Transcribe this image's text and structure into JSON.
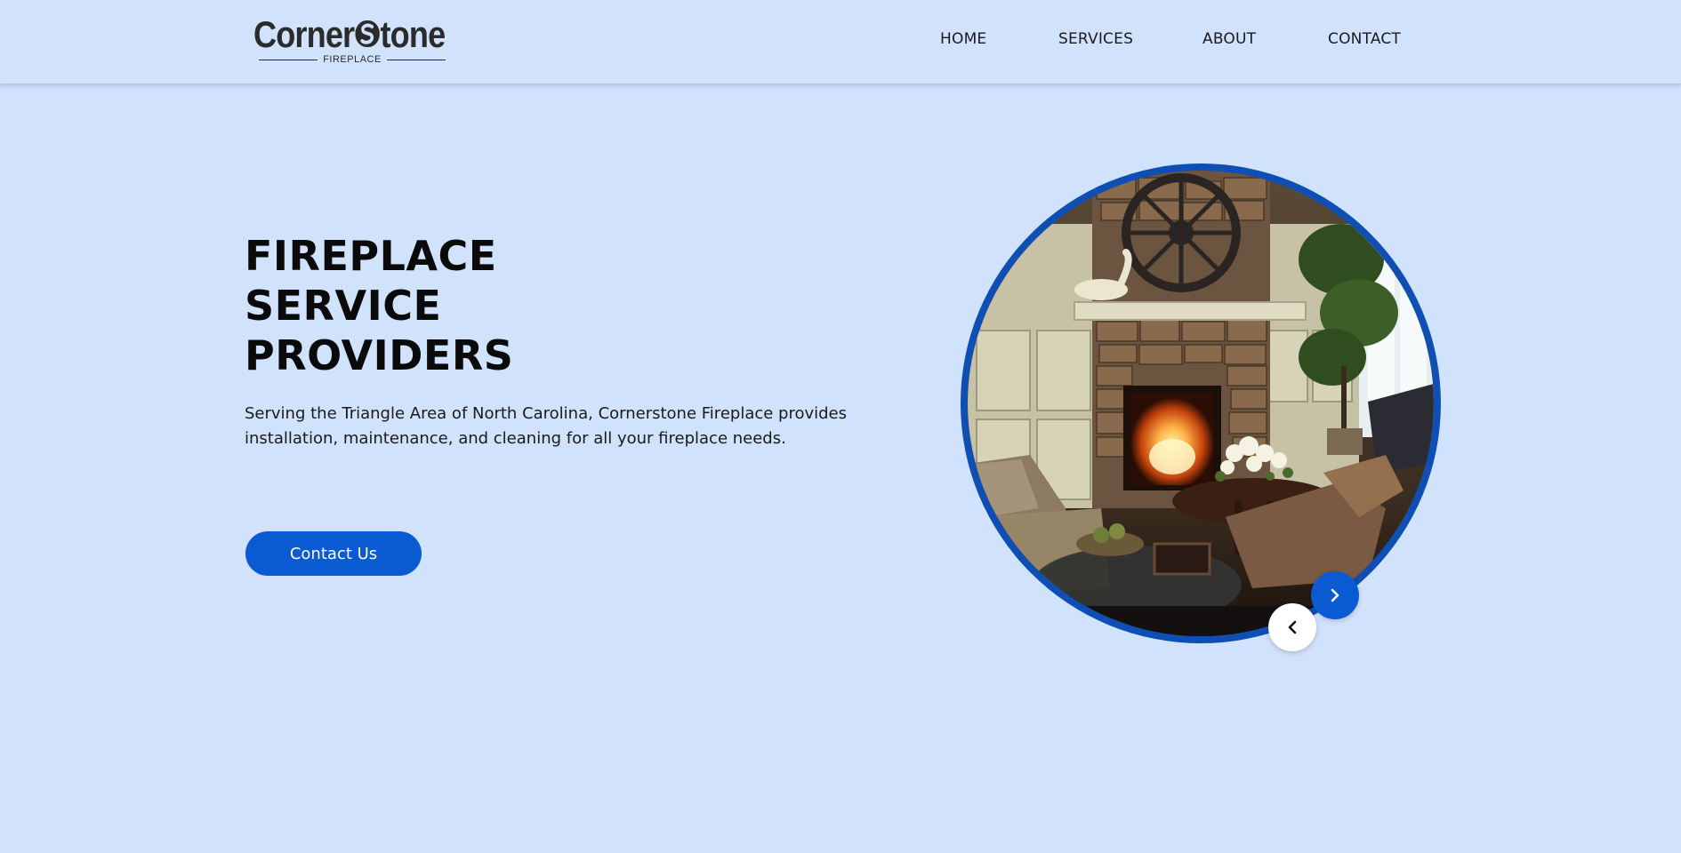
{
  "brand": {
    "name_left": "Corner",
    "name_right": "tone",
    "tagline": "FIREPLACE"
  },
  "nav": {
    "items": [
      {
        "label": "HOME"
      },
      {
        "label": "SERVICES"
      },
      {
        "label": "ABOUT"
      },
      {
        "label": "CONTACT"
      }
    ]
  },
  "hero": {
    "title_lines": [
      "FIREPLACE",
      "SERVICE",
      "PROVIDERS"
    ],
    "description": "Serving the Triangle Area of North Carolina, Cornerstone Fireplace provides installation, maintenance, and cleaning for all your fireplace needs.",
    "cta_label": "Contact Us"
  },
  "carousel": {
    "prev_icon": "chevron-left-icon",
    "next_icon": "chevron-right-icon"
  },
  "colors": {
    "background": "#d1e2fd",
    "accent": "#0a5bd1",
    "ring": "#0f4fb3",
    "text": "#111111"
  }
}
